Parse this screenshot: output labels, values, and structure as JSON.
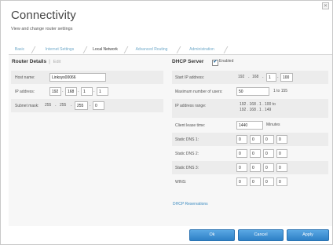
{
  "window": {
    "close_glyph": "✕"
  },
  "header": {
    "title": "Connectivity",
    "subtitle": "View and change router settings"
  },
  "tabs": [
    {
      "label": "Basic",
      "active": false
    },
    {
      "label": "Internet Settings",
      "active": false
    },
    {
      "label": "Local Network",
      "active": true
    },
    {
      "label": "Advanced Routing",
      "active": false
    },
    {
      "label": "Administration",
      "active": false
    }
  ],
  "router_details": {
    "title": "Router Details",
    "separator": "|",
    "edit_label": "Edit",
    "host_name": {
      "label": "Host name:",
      "value": "Linksys00066"
    },
    "ip_address": {
      "label": "IP address:",
      "octets": [
        "192",
        "168",
        "1",
        "1"
      ]
    },
    "subnet_mask": {
      "label": "Subnet mask:",
      "fixed": [
        "255",
        "255"
      ],
      "octets": [
        "255",
        "0"
      ]
    }
  },
  "dhcp": {
    "title": "DHCP Server",
    "enabled_label": "Enabled",
    "enabled": true,
    "check_glyph": "✔",
    "start_ip": {
      "label": "Start IP address:",
      "fixed": [
        "192",
        "168"
      ],
      "octets": [
        "1",
        "100"
      ]
    },
    "max_users": {
      "label": "Maximum number of users:",
      "value": "50",
      "range": "1 to 155"
    },
    "ip_range": {
      "label": "IP address range:",
      "from": "192 . 168 . 1 . 100  to",
      "to": "192 . 168 . 1 . 149"
    },
    "lease_time": {
      "label": "Client lease time:",
      "value": "1440",
      "unit": "Minutes"
    },
    "dns1": {
      "label": "Static DNS 1:",
      "octets": [
        "0",
        "0",
        "0",
        "0"
      ]
    },
    "dns2": {
      "label": "Static DNS 2:",
      "octets": [
        "0",
        "0",
        "0",
        "0"
      ]
    },
    "dns3": {
      "label": "Static DNS 3:",
      "octets": [
        "0",
        "0",
        "0",
        "0"
      ]
    },
    "wins": {
      "label": "WINS:",
      "octets": [
        "0",
        "0",
        "0",
        "0"
      ]
    },
    "reservations_link": "DHCP Reservations"
  },
  "buttons": {
    "ok": "Ok",
    "cancel": "Cancel",
    "apply": "Apply"
  },
  "colors": {
    "accent": "#2e80c6",
    "link": "#3c8bc0",
    "tab_inactive": "#6fa9c9"
  }
}
